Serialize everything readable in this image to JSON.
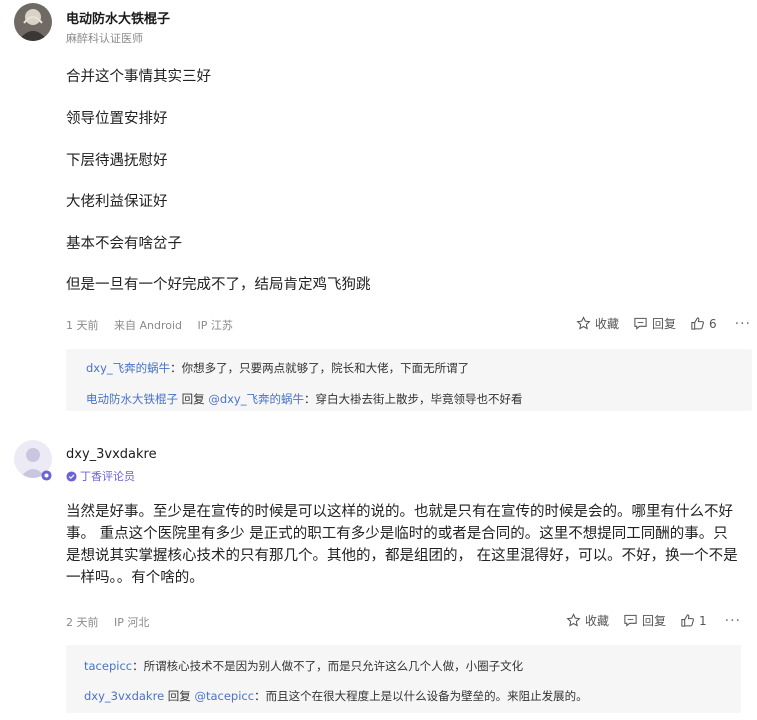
{
  "comments": [
    {
      "author": "电动防水大铁棍子",
      "role": "麻醉科认证医师",
      "paragraphs": [
        "合并这个事情其实三好",
        "领导位置安排好",
        "下层待遇抚慰好",
        "大佬利益保证好",
        "基本不会有啥岔子",
        "但是一旦有一个好完成不了，结局肯定鸡飞狗跳"
      ],
      "meta": {
        "time": "1 天前",
        "source": "来自 Android",
        "ip": "IP 江苏"
      },
      "actions": {
        "favorite": "收藏",
        "reply": "回复",
        "likes": "6",
        "more": "···"
      },
      "replies": [
        {
          "user": "dxy_飞奔的蜗牛",
          "colon": "：",
          "text": "你想多了，只要两点就够了，院长和大佬，下面无所谓了"
        },
        {
          "user": "电动防水大铁棍子",
          "reply_word": " 回复 ",
          "target": "@dxy_飞奔的蜗牛",
          "colon": "：",
          "text": "穿白大褂去街上散步，毕竟领导也不好看"
        }
      ]
    },
    {
      "author": "dxy_3vxdakre",
      "role": "丁香评论员",
      "body": "当然是好事。至少是在宣传的时候是可以这样的说的。也就是只有在宣传的时候是会的。哪里有什么不好事。 重点这个医院里有多少 是正式的职工有多少是临时的或者是合同的。这里不想提同工同酬的事。只是想说其实掌握核心技术的只有那几个。其他的，都是组团的， 在这里混得好，可以。不好，换一个不是一样吗。。有个啥的。",
      "meta": {
        "time": "2 天前",
        "ip": "IP 河北"
      },
      "actions": {
        "favorite": "收藏",
        "reply": "回复",
        "likes": "1",
        "more": "···"
      },
      "replies": [
        {
          "user": "tacepicc",
          "colon": "：",
          "text": "所谓核心技术不是因为别人做不了，而是只允许这么几个人做，小圈子文化"
        },
        {
          "user": "dxy_3vxdakre",
          "reply_word": " 回复 ",
          "target": "@tacepicc",
          "colon": "：",
          "text": "而且这个在很大程度上是以什么设备为壁垒的。来阻止发展的。"
        }
      ]
    }
  ],
  "colors": {
    "link": "#4a73c9",
    "reply_bg": "#f6f6f6",
    "meta": "#8a8a8a"
  }
}
